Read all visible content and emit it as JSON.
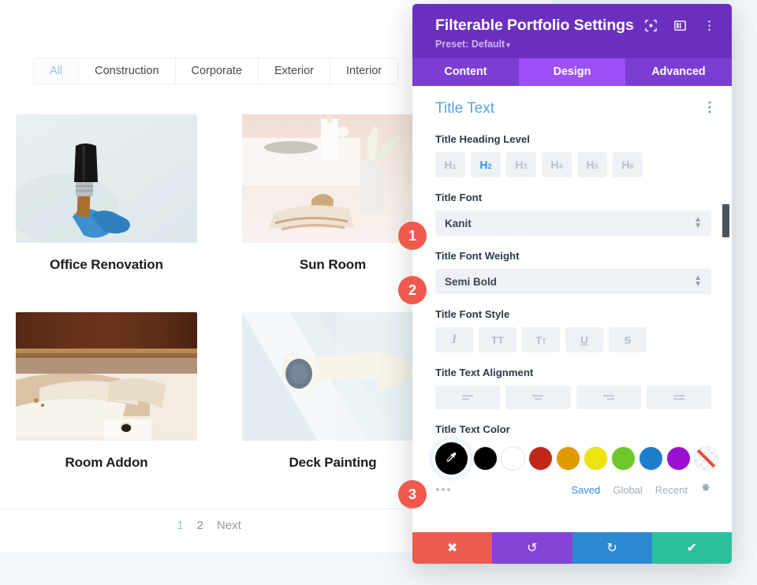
{
  "site": {
    "filters": [
      {
        "label": "All",
        "active": true
      },
      {
        "label": "Construction",
        "active": false
      },
      {
        "label": "Corporate",
        "active": false
      },
      {
        "label": "Exterior",
        "active": false
      },
      {
        "label": "Interior",
        "active": false
      }
    ],
    "projects": [
      {
        "title": "Office Renovation",
        "image": "paintbrush-blue-glove"
      },
      {
        "title": "Sun Room",
        "image": "vase-candle-shelf"
      },
      {
        "title": "Room Addon",
        "image": "wood-beam-construction"
      },
      {
        "title": "Deck Painting",
        "image": "paint-roller-white"
      }
    ],
    "pagination": {
      "current": "1",
      "page2": "2",
      "next": "Next"
    }
  },
  "modal": {
    "title": "Filterable Portfolio Settings",
    "preset": "Preset: Default",
    "preset_caret": "▾",
    "header_icons": [
      {
        "name": "focus-target-icon"
      },
      {
        "name": "layout-panel-icon"
      },
      {
        "name": "kebab-menu-icon"
      }
    ],
    "tabs": [
      {
        "label": "Content",
        "active": false
      },
      {
        "label": "Design",
        "active": true
      },
      {
        "label": "Advanced",
        "active": false
      }
    ],
    "section": {
      "title": "Title Text",
      "kebab": "kebab-menu-icon"
    },
    "fields": {
      "heading_level": {
        "label": "Title Heading Level",
        "options": [
          {
            "tag": "H",
            "num": "1",
            "selected": false
          },
          {
            "tag": "H",
            "num": "2",
            "selected": true
          },
          {
            "tag": "H",
            "num": "3",
            "selected": false
          },
          {
            "tag": "H",
            "num": "4",
            "selected": false
          },
          {
            "tag": "H",
            "num": "5",
            "selected": false
          },
          {
            "tag": "H",
            "num": "6",
            "selected": false
          }
        ]
      },
      "font": {
        "label": "Title Font",
        "value": "Kanit"
      },
      "font_weight": {
        "label": "Title Font Weight",
        "value": "Semi Bold"
      },
      "font_style": {
        "label": "Title Font Style",
        "options": [
          "italic",
          "uppercase",
          "small-caps",
          "underline",
          "strikethrough"
        ]
      },
      "text_alignment": {
        "label": "Title Text Alignment",
        "options": [
          "align-left",
          "align-center",
          "align-right",
          "align-justify"
        ]
      },
      "text_color": {
        "label": "Title Text Color",
        "picker_icon": "eyedropper-icon",
        "swatches": [
          {
            "name": "black",
            "hex": "#000000"
          },
          {
            "name": "white",
            "hex": "#ffffff"
          },
          {
            "name": "red",
            "hex": "#c0271a"
          },
          {
            "name": "orange",
            "hex": "#e09a00"
          },
          {
            "name": "yellow",
            "hex": "#ece40b"
          },
          {
            "name": "green",
            "hex": "#6dc82a"
          },
          {
            "name": "blue",
            "hex": "#1c7ecb"
          },
          {
            "name": "purple",
            "hex": "#9b0fd1"
          },
          {
            "name": "transparent",
            "hex": "none"
          }
        ],
        "footer": {
          "dots": "•••",
          "saved": "Saved",
          "global": "Global",
          "recent": "Recent",
          "gear": "gear-icon"
        }
      }
    },
    "footer_actions": [
      {
        "name": "cancel",
        "icon": "✖",
        "color": "#eb5b4f"
      },
      {
        "name": "undo",
        "icon": "↺",
        "color": "#8543d6"
      },
      {
        "name": "redo",
        "icon": "↻",
        "color": "#2b8ad1"
      },
      {
        "name": "save",
        "icon": "✔",
        "color": "#2dbf9c"
      }
    ]
  },
  "callouts": [
    {
      "number": "1"
    },
    {
      "number": "2"
    },
    {
      "number": "3"
    }
  ]
}
